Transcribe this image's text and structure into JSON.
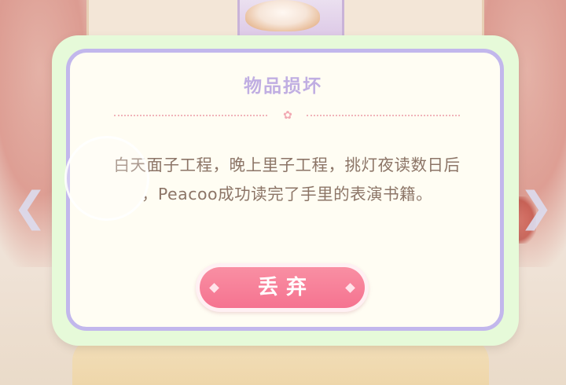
{
  "dialog": {
    "title": "物品损坏",
    "message_lines": [
      "白天面子工程，晚上里子工程，挑灯夜读数日后",
      "，Peacoo成功读完了手里的表演书籍。"
    ],
    "discard_label": "丢弃"
  },
  "icons": {
    "nav_left": "chevron-left-icon",
    "nav_right": "chevron-right-icon",
    "divider": "bow-icon"
  },
  "colors": {
    "title": "#c0aee2",
    "frame_border": "#c2b7ec",
    "outer_bg": "#e6fad9",
    "inner_bg": "#fffdf3",
    "message": "#8c7567",
    "button": "#f57390"
  }
}
